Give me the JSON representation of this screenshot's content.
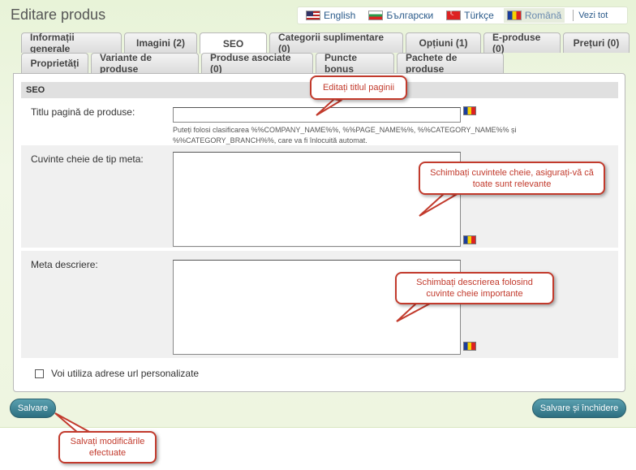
{
  "page": {
    "title": "Editare produs"
  },
  "languages": {
    "items": [
      {
        "label": "English",
        "flag": "flag-us-icon",
        "active": false
      },
      {
        "label": "Български",
        "flag": "flag-bg-icon",
        "active": false
      },
      {
        "label": "Türkçe",
        "flag": "flag-tr-icon",
        "active": false
      },
      {
        "label": "Română",
        "flag": "flag-ro-icon",
        "active": true
      }
    ],
    "view_all": "Vezi tot"
  },
  "tabs": {
    "row1": [
      {
        "label": "Informații generale"
      },
      {
        "label": "Imagini (2)"
      },
      {
        "label": "SEO",
        "active": true
      },
      {
        "label": "Categorii suplimentare (0)"
      },
      {
        "label": "Opțiuni (1)"
      },
      {
        "label": "E-produse (0)"
      },
      {
        "label": "Prețuri (0)"
      }
    ],
    "row2": [
      {
        "label": "Proprietăți"
      },
      {
        "label": "Variante de produse"
      },
      {
        "label": "Produse asociate (0)"
      },
      {
        "label": "Puncte bonus"
      },
      {
        "label": "Pachete de produse"
      }
    ]
  },
  "seo": {
    "section_title": "SEO",
    "page_title_label": "Titlu pagină de produse:",
    "page_title_value": "",
    "page_title_hint": "Puteți folosi clasificarea %%COMPANY_NAME%%, %%PAGE_NAME%%, %%CATEGORY_NAME%% și %%CATEGORY_BRANCH%%, care va fi înlocuită automat.",
    "meta_keywords_label": "Cuvinte cheie de tip meta:",
    "meta_keywords_value": "",
    "meta_description_label": "Meta descriere:",
    "meta_description_value": "",
    "custom_url_label": "Voi utiliza adrese url personalizate",
    "custom_url_checked": false
  },
  "buttons": {
    "save": "Salvare",
    "save_close": "Salvare și închidere"
  },
  "callouts": {
    "title": "Editați titlul paginii",
    "keywords": "Schimbați cuvintele cheie, asigurați-vă că toate sunt relevante",
    "description": "Schimbați descrierea folosind cuvinte cheie importante",
    "save": "Salvați modificările efectuate"
  },
  "colors": {
    "callout_red": "#c23a2c",
    "button_teal": "#2d6f80",
    "background_green": "#e8f3d8"
  }
}
